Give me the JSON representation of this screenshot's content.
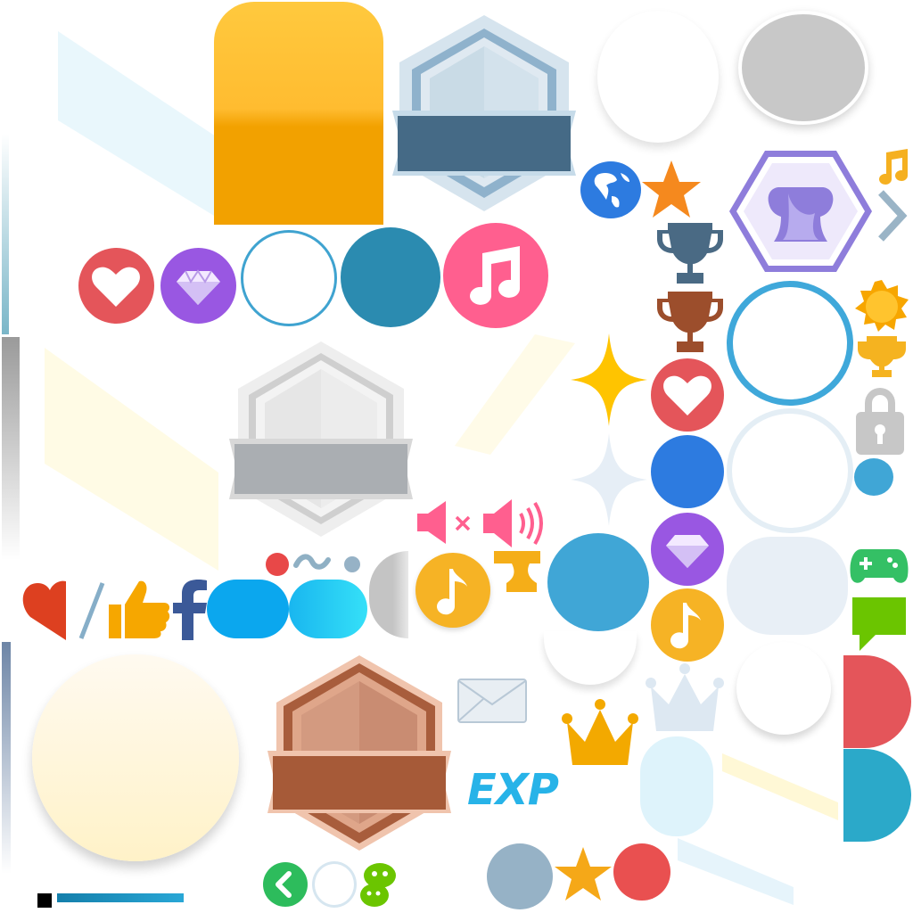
{
  "atlas": {
    "labels": {
      "exp": "EXP"
    },
    "colors": {
      "gold_top": "#ffc53a",
      "gold_bottom": "#f2a100",
      "banner_blue": "#456a86",
      "banner_gray": "#aaaeb2",
      "banner_brown": "#a65a38",
      "heart_red": "#e4555a",
      "gem_purple": "#9957e2",
      "music_pink": "#ff5f8f",
      "music_gold": "#f6b325",
      "teal": "#2b8bb0",
      "ring_blue": "#3fa8da",
      "royal_blue": "#2d7be0",
      "sky_blue": "#40a6d6",
      "trophy_purple": "#8e7ddb",
      "crown_gold": "#f3a900",
      "exp_blue": "#27b3e8",
      "game_green": "#34c065",
      "chat_green": "#6bc500",
      "dot_gray_blue": "#96b2c6",
      "dot_red": "#e95050"
    },
    "icons": [
      "gold-rounded-panel",
      "silver-hexagon-badge",
      "blue-banner",
      "white-circle",
      "gray-circle",
      "globe-icon",
      "orange-star-icon",
      "music-note-icon",
      "trophy-dark-icon",
      "chevron-right-icon",
      "purple-trophy-hex-badge",
      "heart-circle-icon",
      "gem-circle-icon",
      "music-circle-icon",
      "trophy-bronze-icon",
      "sun-icon",
      "gold-trophy-icon",
      "lock-icon",
      "sparkle-icon",
      "mute-icon",
      "speaker-icon",
      "facebook-icon",
      "thumbs-up-icon",
      "heart-icon",
      "bronze-hexagon-badge",
      "mail-icon",
      "crown-icon",
      "exp-label",
      "gamepad-icon",
      "chat-icon",
      "back-button-icon",
      "wechat-icon",
      "star-icon"
    ]
  }
}
